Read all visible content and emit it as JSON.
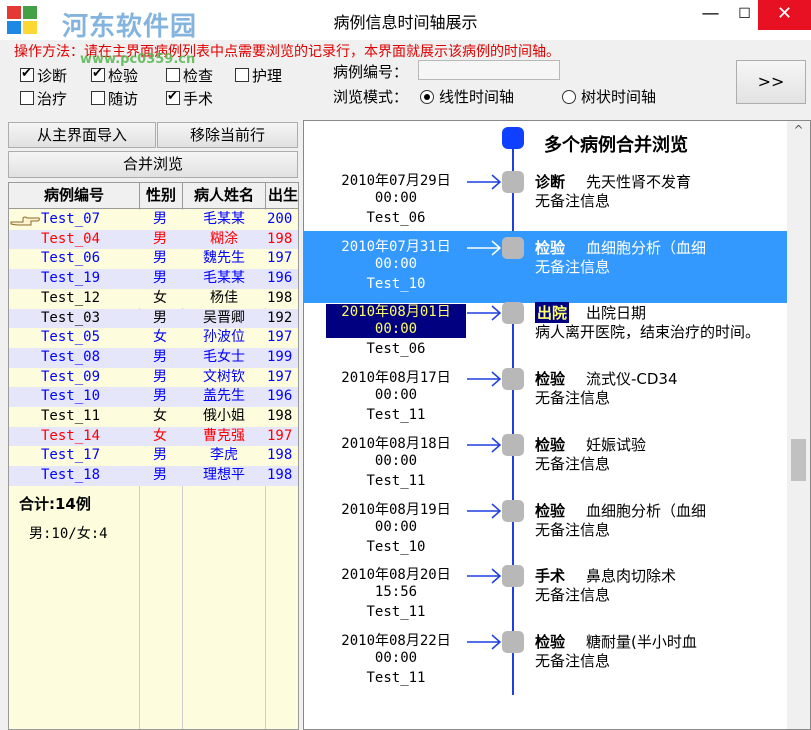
{
  "window": {
    "title": "病例信息时间轴展示",
    "minimize": "—",
    "maximize": "☐",
    "close": "✕"
  },
  "watermark": {
    "text": "河东软件园",
    "url": "www.pc0359.cn"
  },
  "hint": "操作方法：请在主界面病例列表中点需要浏览的记录行，本界面就展示该病例的时间轴。",
  "filters": {
    "diagnose": {
      "label": "诊断",
      "checked": true
    },
    "lab": {
      "label": "检验",
      "checked": true
    },
    "exam": {
      "label": "检查",
      "checked": false
    },
    "nursing": {
      "label": "护理",
      "checked": false
    },
    "treat": {
      "label": "治疗",
      "checked": false
    },
    "followup": {
      "label": "随访",
      "checked": false
    },
    "surgery": {
      "label": "手术",
      "checked": true
    }
  },
  "case_no_label": "病例编号：",
  "browse_mode_label": "浏览模式：",
  "mode_linear": "线性时间轴",
  "mode_tree": "树状时间轴",
  "expand_button": ">>",
  "buttons": {
    "import": "从主界面导入",
    "remove": "移除当前行",
    "merge": "合并浏览"
  },
  "grid": {
    "headers": [
      "病例编号",
      "性别",
      "病人姓名",
      "出生"
    ],
    "rows": [
      {
        "code": "Test_07",
        "sex": "男",
        "name": "毛某某",
        "birth": "200",
        "color": "#0000ff"
      },
      {
        "code": "Test_04",
        "sex": "男",
        "name": "糊涂",
        "birth": "198",
        "color": "#ff0000"
      },
      {
        "code": "Test_06",
        "sex": "男",
        "name": "魏先生",
        "birth": "197",
        "color": "#0000ff"
      },
      {
        "code": "Test_19",
        "sex": "男",
        "name": "毛某某",
        "birth": "196",
        "color": "#0000ff"
      },
      {
        "code": "Test_12",
        "sex": "女",
        "name": "杨佳",
        "birth": "198",
        "color": "#000000"
      },
      {
        "code": "Test_03",
        "sex": "男",
        "name": "吴晋卿",
        "birth": "192",
        "color": "#000000"
      },
      {
        "code": "Test_05",
        "sex": "女",
        "name": "孙波位",
        "birth": "197",
        "color": "#0000ff"
      },
      {
        "code": "Test_08",
        "sex": "男",
        "name": "毛女士",
        "birth": "199",
        "color": "#0000ff"
      },
      {
        "code": "Test_09",
        "sex": "男",
        "name": "文树钦",
        "birth": "197",
        "color": "#0000ff"
      },
      {
        "code": "Test_10",
        "sex": "男",
        "name": "盖先生",
        "birth": "196",
        "color": "#0000ff"
      },
      {
        "code": "Test_11",
        "sex": "女",
        "name": "俄小姐",
        "birth": "198",
        "color": "#000000"
      },
      {
        "code": "Test_14",
        "sex": "女",
        "name": "曹克强",
        "birth": "197",
        "color": "#ff0000"
      },
      {
        "code": "Test_17",
        "sex": "男",
        "name": "李虎",
        "birth": "198",
        "color": "#0000ff"
      },
      {
        "code": "Test_18",
        "sex": "男",
        "name": "理想平",
        "birth": "198",
        "color": "#0000ff"
      }
    ],
    "total": "合计:14例",
    "gender_summary": "男:10/女:4"
  },
  "timeline": {
    "title": "多个病例合并浏览",
    "events": [
      {
        "date": "2010年07月29日",
        "time": "00:00",
        "id": "Test_06",
        "cat": "诊断",
        "desc": "先天性肾不发育",
        "note": "无备注信息"
      },
      {
        "date": "2010年07月31日",
        "time": "00:00",
        "id": "Test_10",
        "cat": "检验",
        "desc": "血细胞分析（血细",
        "note": "无备注信息"
      },
      {
        "date": "2010年08月01日",
        "time": "00:00",
        "id": "Test_06",
        "cat": "出院",
        "desc": "出院日期",
        "note": "病人离开医院，结束治疗的时间。"
      },
      {
        "date": "2010年08月17日",
        "time": "00:00",
        "id": "Test_11",
        "cat": "检验",
        "desc": "流式仪-CD34",
        "note": "无备注信息"
      },
      {
        "date": "2010年08月18日",
        "time": "00:00",
        "id": "Test_11",
        "cat": "检验",
        "desc": "妊娠试验",
        "note": "无备注信息"
      },
      {
        "date": "2010年08月19日",
        "time": "00:00",
        "id": "Test_10",
        "cat": "检验",
        "desc": "血细胞分析（血细",
        "note": "无备注信息"
      },
      {
        "date": "2010年08月20日",
        "time": "15:56",
        "id": "Test_11",
        "cat": "手术",
        "desc": "鼻息肉切除术",
        "note": "无备注信息"
      },
      {
        "date": "2010年08月22日",
        "time": "00:00",
        "id": "Test_11",
        "cat": "检验",
        "desc": "糖耐量(半小时血",
        "note": "无备注信息"
      }
    ]
  }
}
